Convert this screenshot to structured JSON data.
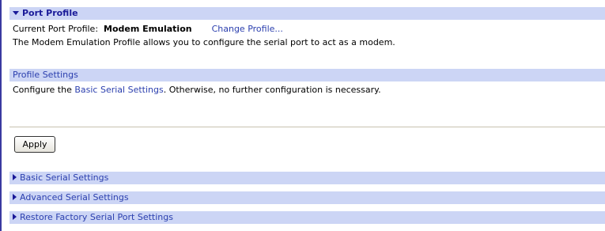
{
  "port_profile": {
    "title": "Port Profile",
    "current_label": "Current Port Profile:",
    "current_value": "Modem Emulation",
    "change_link": "Change Profile...",
    "description": "The Modem Emulation Profile allows you to configure the serial port to act as a modem."
  },
  "profile_settings": {
    "title": "Profile Settings",
    "text_before": "Configure the ",
    "link": "Basic Serial Settings",
    "text_after": ". Otherwise, no further configuration is necessary."
  },
  "apply_label": "Apply",
  "sections": [
    {
      "label": "Basic Serial Settings"
    },
    {
      "label": "Advanced Serial Settings"
    },
    {
      "label": "Restore Factory Serial Port Settings"
    }
  ],
  "colors": {
    "header_bg": "#ccd5f5",
    "header_text": "#1a1a99",
    "link": "#2b3fae"
  }
}
